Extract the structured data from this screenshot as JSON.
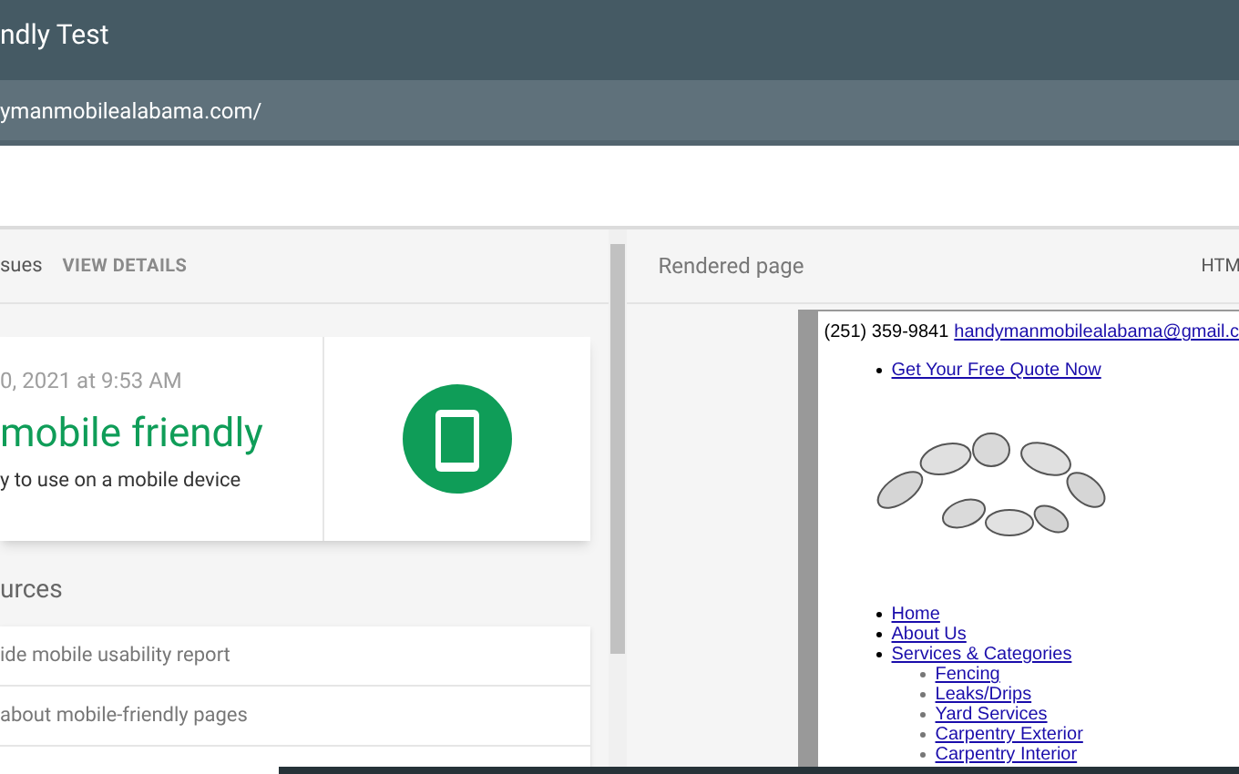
{
  "header": {
    "title": "ndly Test",
    "url": "ymanmobilealabama.com/"
  },
  "left_panel": {
    "tabs": [
      {
        "label": "sues",
        "kind": "text"
      },
      {
        "label": "VIEW DETAILS",
        "kind": "link"
      }
    ],
    "result": {
      "date": "0, 2021 at 9:53 AM",
      "verdict": "mobile friendly",
      "detail": "y to use on a mobile device"
    },
    "resources_title": "urces",
    "resources": [
      "ide mobile usability report",
      "about mobile-friendly pages"
    ]
  },
  "right_panel": {
    "title": "Rendered page",
    "tab": "HTM",
    "rendered": {
      "phone": "(251) 359-9841",
      "email": "handymanmobilealabama@gmail.c",
      "quote_link": "Get Your Free Quote Now",
      "nav": [
        {
          "label": "Home"
        },
        {
          "label": "About Us"
        },
        {
          "label": "Services & Categories",
          "children": [
            {
              "label": "Fencing"
            },
            {
              "label": "Leaks/Drips"
            },
            {
              "label": "Yard Services"
            },
            {
              "label": "Carpentry Exterior"
            },
            {
              "label": "Carpentry Interior"
            }
          ]
        }
      ]
    }
  }
}
